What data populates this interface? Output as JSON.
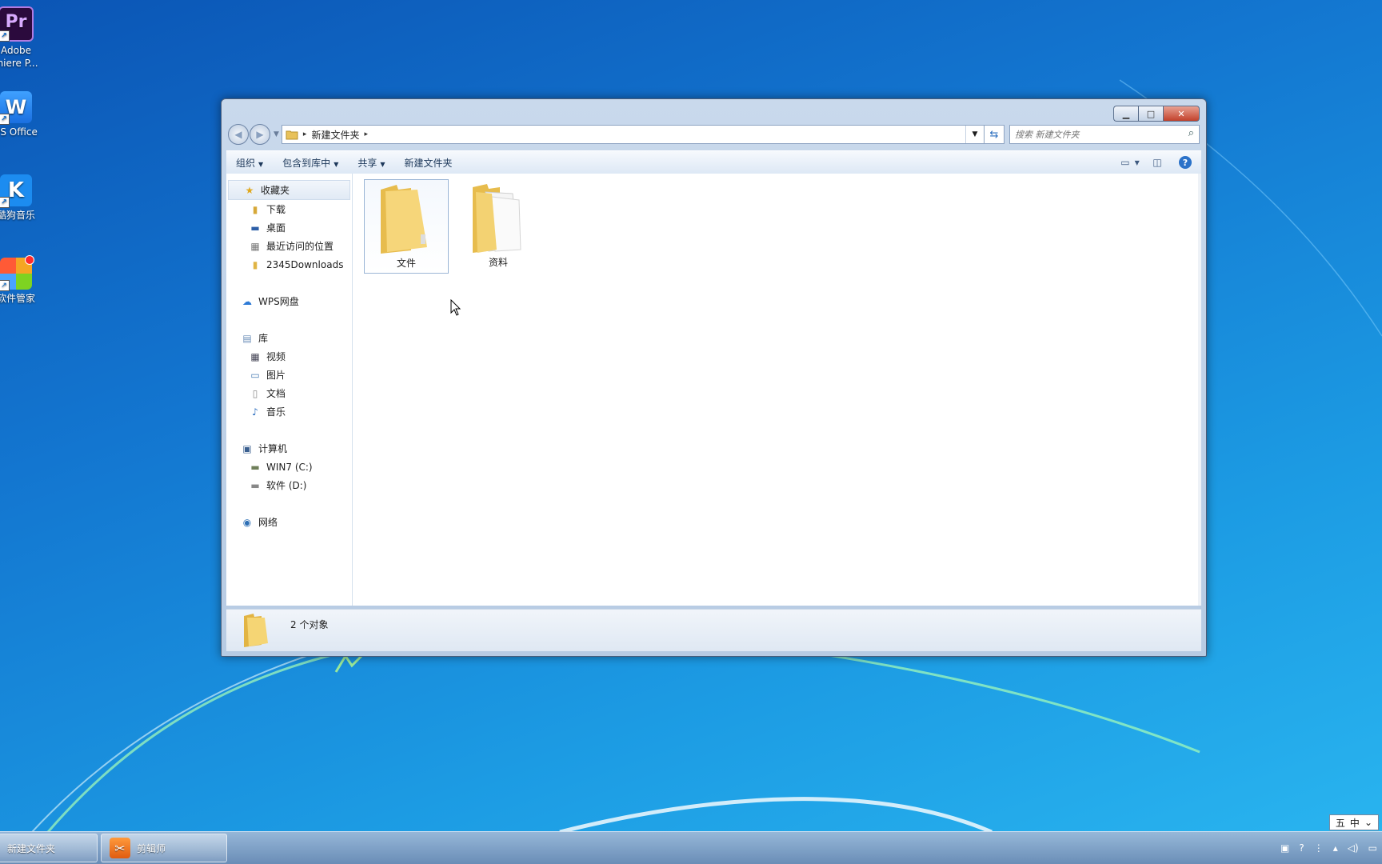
{
  "desktop": {
    "icons": [
      {
        "label": "Adobe",
        "label2": "miere P...",
        "glyph": "Pr"
      },
      {
        "label": "PS Office",
        "glyph": "W"
      },
      {
        "label": "酷狗音乐",
        "glyph": "K"
      },
      {
        "label": "软件管家",
        "glyph": ""
      }
    ]
  },
  "window": {
    "controls": {
      "minimize": "▁",
      "maximize": "□",
      "close": "✕"
    },
    "address": {
      "crumb": "新建文件夹"
    },
    "search": {
      "placeholder": "搜索 新建文件夹"
    },
    "commands": [
      {
        "label": "组织",
        "has_menu": true
      },
      {
        "label": "包含到库中",
        "has_menu": true
      },
      {
        "label": "共享",
        "has_menu": true
      },
      {
        "label": "新建文件夹",
        "has_menu": false
      }
    ],
    "nav": {
      "favorites": {
        "label": "收藏夹",
        "items": [
          "下载",
          "桌面",
          "最近访问的位置",
          "2345Downloads"
        ]
      },
      "wps": {
        "label": "WPS网盘"
      },
      "library": {
        "label": "库",
        "items": [
          "视频",
          "图片",
          "文档",
          "音乐"
        ]
      },
      "computer": {
        "label": "计算机",
        "items": [
          "WIN7 (C:)",
          "软件 (D:)"
        ]
      },
      "network": {
        "label": "网络"
      }
    },
    "files": [
      {
        "name": "文件",
        "selected": true
      },
      {
        "name": "资料",
        "selected": false
      }
    ],
    "status": {
      "count": "2 个对象"
    }
  },
  "taskbar": {
    "items": [
      {
        "label": "新建文件夹"
      },
      {
        "label": "剪辑师"
      }
    ],
    "tray": {
      "ime_mode": "五",
      "ime_lang": "中"
    }
  },
  "colors": {
    "accent": "#2b72c9",
    "folder": "#f0c75a",
    "close": "#c2412b"
  }
}
